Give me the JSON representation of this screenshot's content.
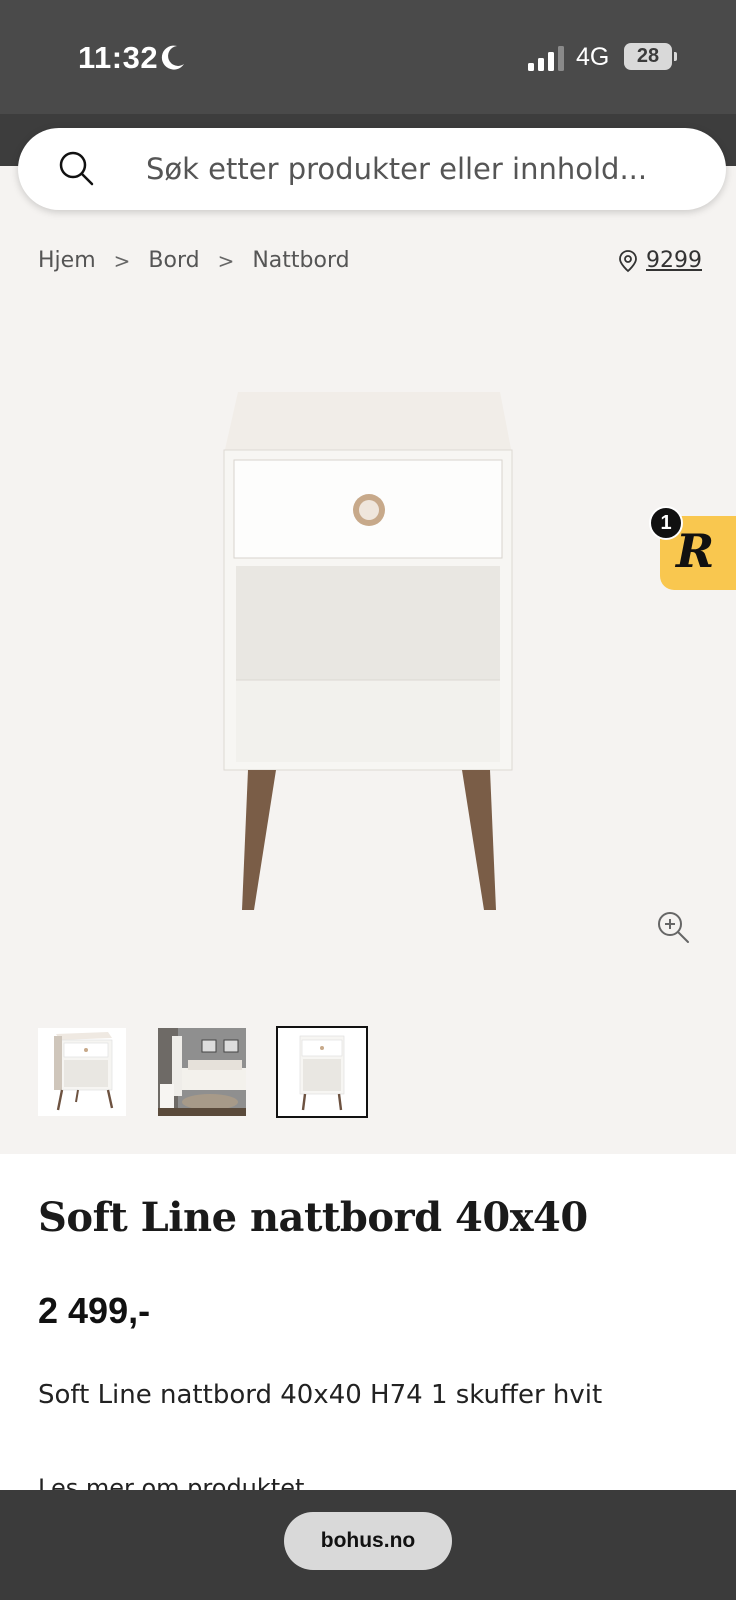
{
  "status_bar": {
    "time": "11:32",
    "network": "4G",
    "battery": "28"
  },
  "search": {
    "placeholder": "Søk etter produkter eller innhold..."
  },
  "breadcrumb": {
    "items": [
      "Hjem",
      "Bord",
      "Nattbord"
    ],
    "separator": ">"
  },
  "store": {
    "code": "9299"
  },
  "floating_badge": {
    "count": "1",
    "letter": "R",
    "color": "#f9c74f"
  },
  "product": {
    "title": "Soft Line nattbord 40x40",
    "price": "2 499,-",
    "description": "Soft Line nattbord 40x40 H74 1 skuffer hvit",
    "read_more": "Les mer om produktet",
    "thumbnails": [
      "thumbnail-angle",
      "thumbnail-room",
      "thumbnail-front"
    ],
    "selected_thumbnail": 3
  },
  "browser": {
    "url": "bohus.no"
  },
  "icons": {
    "search": "search-icon",
    "location": "location-pin-icon",
    "zoom": "zoom-in-icon",
    "moon": "moon-icon",
    "signal": "signal-icon"
  }
}
